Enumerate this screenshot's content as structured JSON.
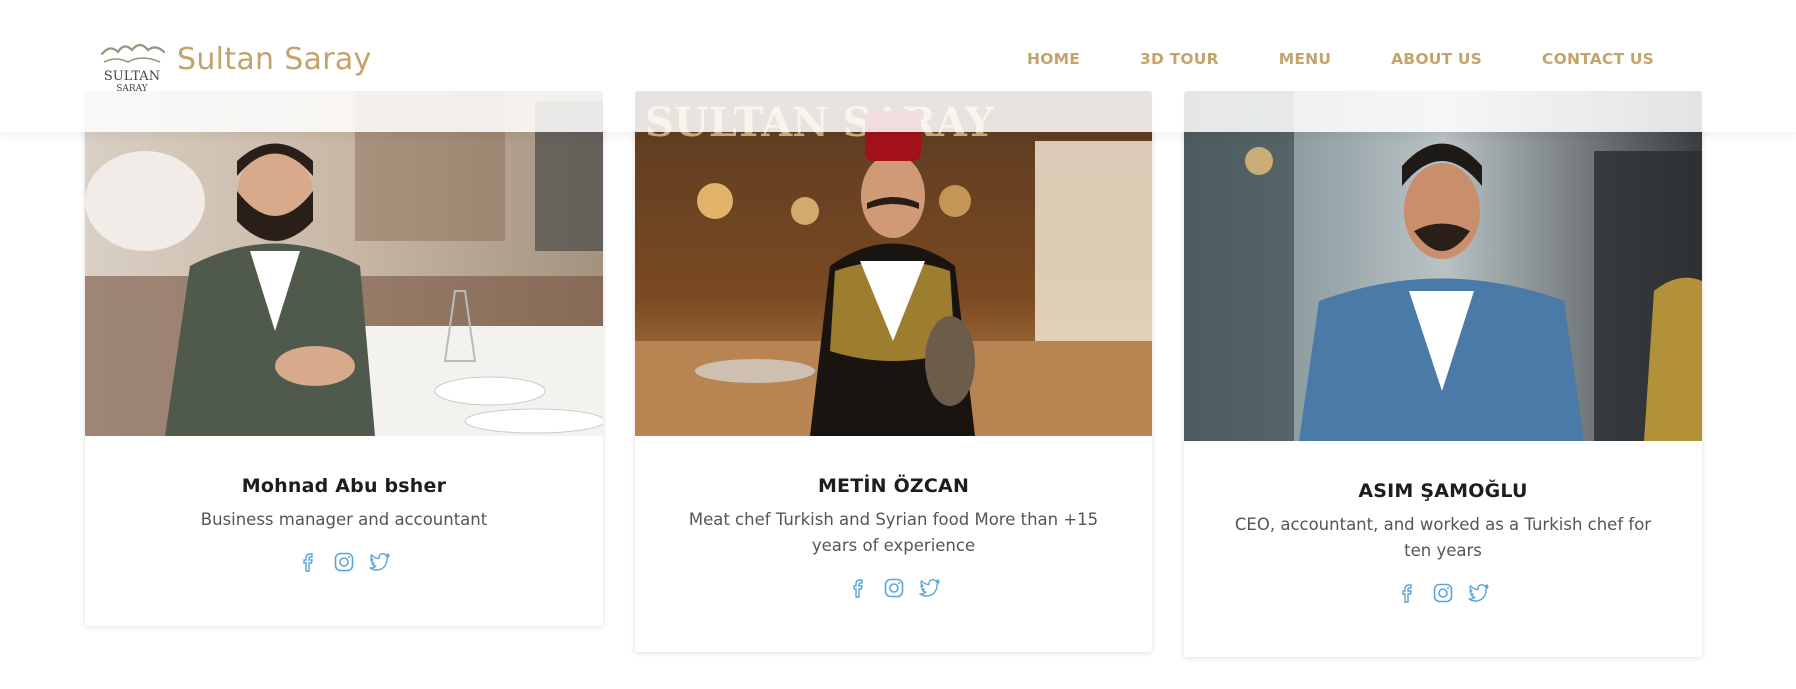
{
  "header": {
    "brand": "Sultan Saray",
    "logo_text_top": "SULTAN",
    "logo_text_bottom": "SARAY",
    "nav": [
      "HOME",
      "3D TOUR",
      "MENU",
      "ABOUT US",
      "CONTACT US"
    ]
  },
  "team": [
    {
      "name": "Mohnad Abu bsher",
      "role": "Business manager and accountant",
      "socials": [
        "facebook-icon",
        "instagram-icon",
        "twitter-icon"
      ]
    },
    {
      "name": "METİN ÖZCAN",
      "role": "Meat chef Turkish and Syrian food More than +15 years of experience",
      "socials": [
        "facebook-icon",
        "instagram-icon",
        "twitter-icon"
      ]
    },
    {
      "name": "ASIM ŞAMOĞLU",
      "role": "CEO, accountant, and worked as a Turkish chef for ten years",
      "socials": [
        "facebook-icon",
        "instagram-icon",
        "twitter-icon"
      ]
    }
  ],
  "colors": {
    "brand_gold": "#c4a46b",
    "social_blue": "#5aa6d6",
    "name_text": "#1d1d1d",
    "role_text": "#555555"
  }
}
